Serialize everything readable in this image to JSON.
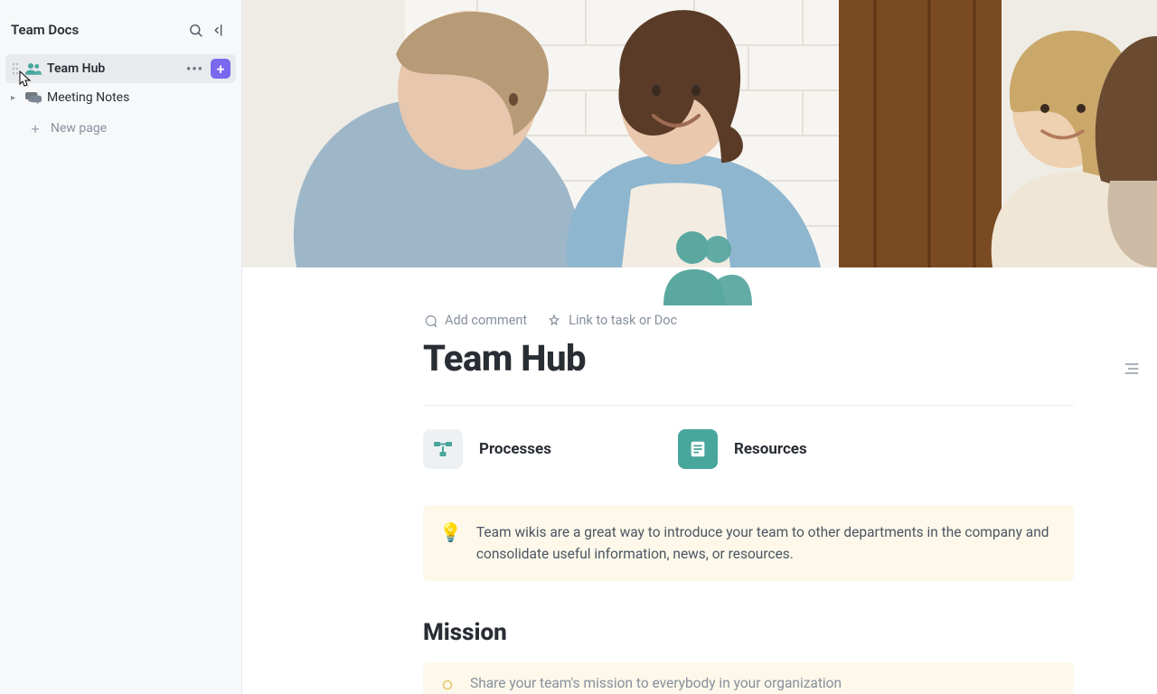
{
  "sidebar": {
    "title": "Team Docs",
    "items": [
      {
        "label": "Team Hub"
      },
      {
        "label": "Meeting Notes"
      }
    ],
    "new_page_label": "New page"
  },
  "doc": {
    "actions": {
      "add_comment": "Add comment",
      "link_task": "Link to task or Doc"
    },
    "title": "Team Hub",
    "sections": [
      {
        "label": "Processes"
      },
      {
        "label": "Resources"
      }
    ],
    "callout": "Team wikis are a great way to introduce your team to other departments in the company and consolidate useful information, news, or resources.",
    "mission_heading": "Mission",
    "mission_hint": "Share your team's mission to everybody in your organization"
  }
}
